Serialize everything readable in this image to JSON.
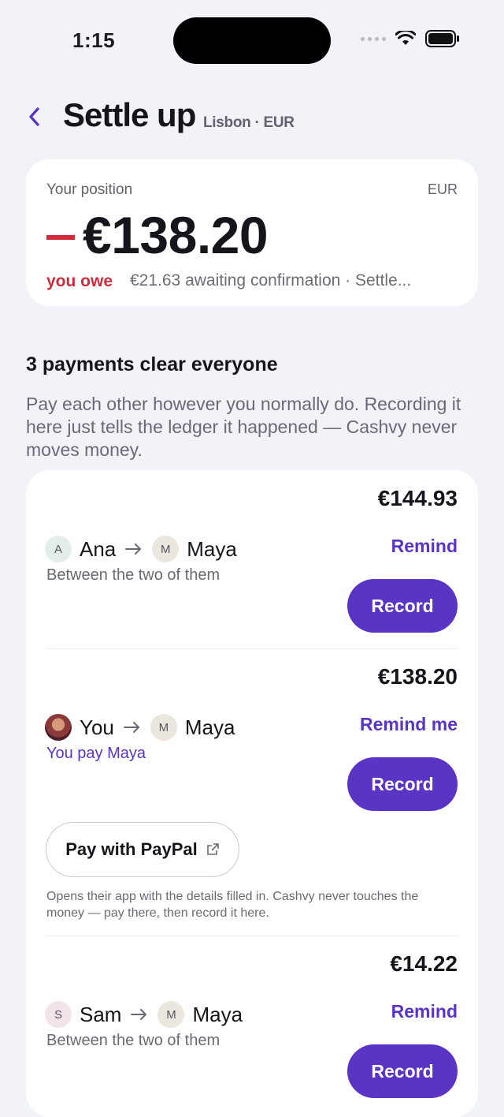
{
  "status": {
    "time": "1:15"
  },
  "header": {
    "title": "Settle up",
    "subtitle": "Lisbon · EUR"
  },
  "position": {
    "label": "Your position",
    "currency": "EUR",
    "amount": "€138.20",
    "owe_label": "you owe",
    "status_text": "€21.63 awaiting confirmation · Settle..."
  },
  "section": {
    "title": "3 payments clear everyone",
    "description": "Pay each other however you normally do. Recording it here just tells the ledger it happened — Cashvy never moves money."
  },
  "payments": [
    {
      "amount": "€144.93",
      "from": {
        "initial": "A",
        "name": "Ana"
      },
      "to": {
        "initial": "M",
        "name": "Maya"
      },
      "description": "Between the two of them",
      "remind_label": "Remind",
      "record_label": "Record"
    },
    {
      "amount": "€138.20",
      "from": {
        "initial": "",
        "name": "You"
      },
      "to": {
        "initial": "M",
        "name": "Maya"
      },
      "description": "You pay Maya",
      "remind_label": "Remind me",
      "record_label": "Record",
      "paypal_label": "Pay with PayPal",
      "paypal_note": "Opens their app with the details filled in. Cashvy never touches the money — pay there, then record it here."
    },
    {
      "amount": "€14.22",
      "from": {
        "initial": "S",
        "name": "Sam"
      },
      "to": {
        "initial": "M",
        "name": "Maya"
      },
      "description": "Between the two of them",
      "remind_label": "Remind",
      "record_label": "Record"
    }
  ],
  "colors": {
    "accent": "#5a34c4",
    "negative": "#d12a3b",
    "background": "#f2f3f8"
  }
}
